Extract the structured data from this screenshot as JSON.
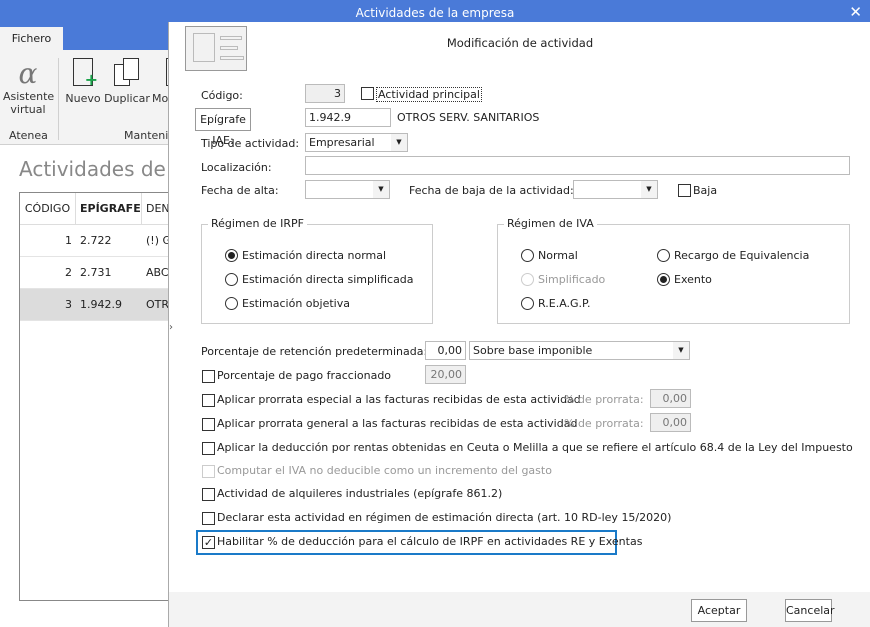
{
  "window": {
    "title": "Actividades de la empresa",
    "close_icon": "close-icon"
  },
  "ribbon": {
    "tab": "Fichero",
    "buttons": [
      {
        "label": "Asistente\nvirtual",
        "l1": "Asistente",
        "l2": "virtual",
        "icon": "alpha-icon"
      },
      {
        "label": "Nuevo",
        "icon": "new-document-icon"
      },
      {
        "label": "Duplicar",
        "icon": "duplicate-icon"
      },
      {
        "label": "Mo",
        "icon": "modify-icon"
      }
    ],
    "groups": [
      "Atenea",
      "Manteni"
    ]
  },
  "app": {
    "title": "Actividades de la",
    "columns": [
      "CÓDIGO",
      "EPÍGRAFE",
      "DEN"
    ],
    "rows": [
      [
        "1",
        "2.722",
        "(!) G"
      ],
      [
        "2",
        "2.731",
        "ABC"
      ],
      [
        "3",
        "1.942.9",
        "OTR"
      ]
    ]
  },
  "dialog": {
    "title": "Modificación de actividad",
    "codigo_label": "Código:",
    "codigo": "3",
    "actividad_principal": "Actividad principal",
    "actividad_principal_checked": false,
    "epigrafe_button": "Epígrafe IAE:",
    "epigrafe": "1.942.9",
    "epigrafe_desc": "OTROS SERV. SANITARIOS",
    "tipo_label": "Tipo de actividad:",
    "tipo": "Empresarial",
    "localizacion_label": "Localización:",
    "localizacion": "",
    "fecha_alta_label": "Fecha de alta:",
    "fecha_alta": "",
    "fecha_baja_label": "Fecha de baja de la actividad:",
    "fecha_baja": "",
    "baja": "Baja",
    "baja_checked": false,
    "irpf": {
      "title": "Régimen de IRPF",
      "options": [
        "Estimación directa normal",
        "Estimación directa simplificada",
        "Estimación objetiva"
      ],
      "selected": 0
    },
    "iva": {
      "title": "Régimen de IVA",
      "options": [
        "Normal",
        "Simplificado",
        "R.E.A.G.P.",
        "Recargo de Equivalencia",
        "Exento"
      ],
      "selected": "Exento",
      "disabled": "Simplificado"
    },
    "retencion_label": "Porcentaje de retención predeterminada:",
    "retencion": "0,00",
    "retencion_base": "Sobre base imponible",
    "pago_fracc": "Porcentaje de pago fraccionado",
    "pago_fracc_value": "20,00",
    "prorrata_especial": "Aplicar prorrata especial a las facturas recibidas de esta actividad",
    "prorrata_label": "% de prorrata:",
    "prorrata_especial_value": "0,00",
    "prorrata_general": "Aplicar prorrata general a las facturas recibidas de esta actividad",
    "prorrata_general_value": "0,00",
    "ceuta": "Aplicar la deducción por rentas obtenidas en Ceuta o Melilla a que se refiere el artículo 68.4 de la Ley del Impuesto",
    "computar_iva": "Computar el IVA no deducible como un incremento del gasto",
    "alquileres": "Actividad de alquileres industriales (epígrafe 861.2)",
    "declarar": "Declarar esta actividad en régimen de estimación directa (art. 10 RD-ley 15/2020)",
    "habilitar": "Habilitar % de deducción para el cálculo de IRPF en actividades RE y Exentas",
    "habilitar_checked": true,
    "accept": "Aceptar",
    "cancel": "Cancelar",
    "focus_color": "#1a7ac8"
  }
}
